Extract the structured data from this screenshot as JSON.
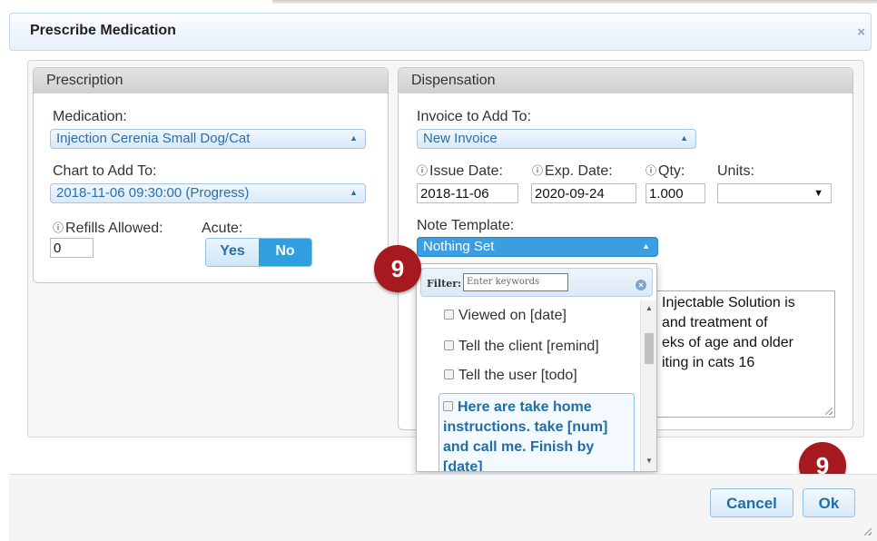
{
  "dialog": {
    "title": "Prescribe Medication",
    "close_glyph": "×"
  },
  "prescription": {
    "heading": "Prescription",
    "medication_label": "Medication:",
    "medication_value": "Injection Cerenia Small Dog/Cat",
    "chart_label": "Chart to Add To:",
    "chart_value": "2018-11-06 09:30:00 (Progress)",
    "refills_label": "Refills Allowed:",
    "refills_value": "0",
    "acute_label": "Acute:",
    "acute_yes": "Yes",
    "acute_no": "No",
    "acute_selected": "No"
  },
  "dispensation": {
    "heading": "Dispensation",
    "invoice_label": "Invoice to Add To:",
    "invoice_value": "New Invoice",
    "issue_label": "Issue Date:",
    "issue_value": "2018-11-06",
    "exp_label": "Exp. Date:",
    "exp_value": "2020-09-24",
    "qty_label": "Qty:",
    "qty_value": "1.000",
    "units_label": "Units:",
    "units_value": "",
    "note_label": "Note Template:",
    "note_value": "Nothing Set",
    "note_text_lines": [
      "Injectable Solution is",
      "and treatment of",
      "eks of age and older",
      "iting in cats 16"
    ]
  },
  "note_dropdown": {
    "filter_label": "Filter:",
    "filter_placeholder": "Enter keywords",
    "options": [
      "Viewed on [date]",
      "Tell the client [remind]",
      "Tell the user [todo]"
    ],
    "active_option_lines": [
      "Here are take home",
      "instructions. take [num]",
      "and call me. Finish by",
      "[date]"
    ]
  },
  "badges": {
    "filter_step": "9",
    "ok_step": "9",
    "color": "#a6191f"
  },
  "footer": {
    "cancel_label": "Cancel",
    "ok_label": "Ok"
  },
  "colors": {
    "accent": "#2f9fe0",
    "link_blue": "#1f6ea8"
  }
}
